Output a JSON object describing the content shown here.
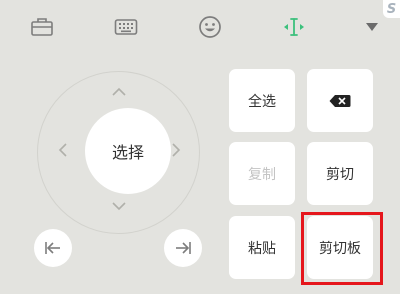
{
  "toolbar": {
    "icons": [
      "briefcase-icon",
      "keyboard-icon",
      "emoji-icon",
      "text-cursor-icon",
      "collapse-icon"
    ],
    "active_color": "#3cc07c",
    "brand_mark": "S"
  },
  "dpad": {
    "center_label": "选择"
  },
  "keys": {
    "select_all": "全选",
    "copy": "复制",
    "cut": "剪切",
    "paste": "粘贴",
    "clipboard": "剪切板"
  },
  "colors": {
    "background": "#e3e3df",
    "key": "#ffffff",
    "highlight": "#e5161c"
  }
}
